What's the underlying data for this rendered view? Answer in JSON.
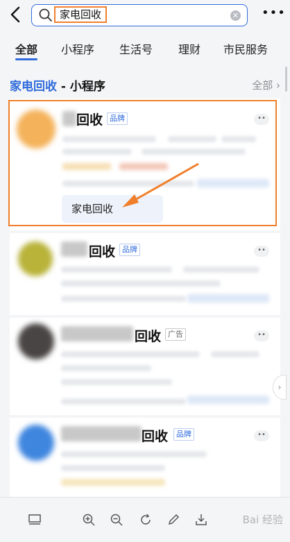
{
  "search": {
    "query": "家电回收"
  },
  "tabs": [
    {
      "label": "全部",
      "active": true
    },
    {
      "label": "小程序",
      "active": false
    },
    {
      "label": "生活号",
      "active": false
    },
    {
      "label": "理财",
      "active": false
    },
    {
      "label": "市民服务",
      "active": false
    }
  ],
  "section": {
    "title_highlight": "家电回收",
    "title_rest": " - 小程序",
    "all_label": "全部"
  },
  "results": [
    {
      "name": "回收",
      "badge": "品牌",
      "chip": "家电回收",
      "avatar_color": "#f4b25a"
    },
    {
      "name": "回收",
      "badge": "品牌",
      "avatar_color": "#b9b33a"
    },
    {
      "name": "回收",
      "badge": "广告",
      "avatar_color": "#4a4545"
    },
    {
      "name": "回收",
      "badge": "品牌",
      "avatar_color": "#3f86df"
    }
  ],
  "icons": {
    "back": "back-arrow-icon",
    "search": "search-icon",
    "clear": "clear-icon",
    "more": "more-icon",
    "bottom": [
      "layout-icon",
      "zoom-in-icon",
      "zoom-out-icon",
      "rotate-icon",
      "edit-icon",
      "download-icon"
    ]
  },
  "watermark": "Bai 经验",
  "colors": {
    "accent": "#2f6bdb",
    "annotation": "#f07f2b"
  }
}
